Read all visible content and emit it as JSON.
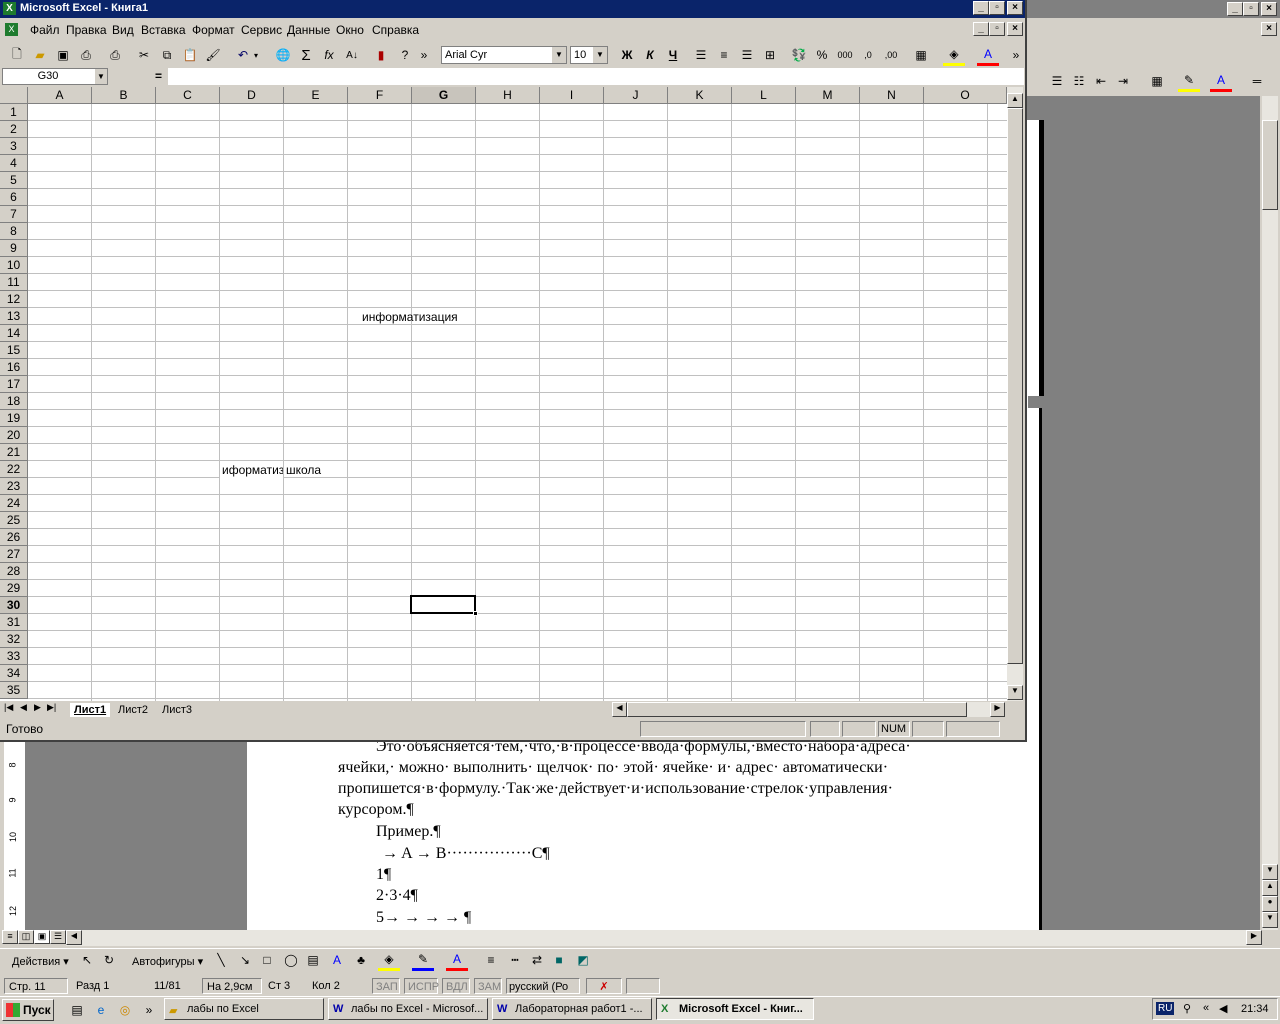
{
  "excel": {
    "title": "Microsoft Excel - Книга1",
    "menu": [
      "Файл",
      "Правка",
      "Вид",
      "Вставка",
      "Формат",
      "Сервис",
      "Данные",
      "Окно",
      "Справка"
    ],
    "font_name": "Arial Cyr",
    "font_size": "10",
    "bold": "Ж",
    "italic": "К",
    "underline": "Ч",
    "name_box": "G30",
    "formula_eq": "=",
    "columns": [
      "A",
      "B",
      "C",
      "D",
      "E",
      "F",
      "G",
      "H",
      "I",
      "J",
      "K",
      "L",
      "M",
      "N",
      "O"
    ],
    "rows": [
      "1",
      "2",
      "3",
      "4",
      "5",
      "6",
      "7",
      "8",
      "9",
      "10",
      "11",
      "12",
      "13",
      "14",
      "15",
      "16",
      "17",
      "18",
      "19",
      "20",
      "21",
      "22",
      "23",
      "24",
      "25",
      "26",
      "27",
      "28",
      "29",
      "30",
      "31",
      "32",
      "33",
      "34",
      "35"
    ],
    "cells": {
      "F13": "информатизация",
      "D22": "иформатиз",
      "E22": "школа"
    },
    "sheets": [
      "Лист1",
      "Лист2",
      "Лист3"
    ],
    "status_ready": "Готово",
    "status_num": "NUM"
  },
  "word": {
    "paragraph_lines": [
      "Это·объясняется·тем,·что,·в·процессе·ввода·формулы,·вместо·набора·адреса·",
      "ячейки,· можно· выполнить· щелчок· по· этой· ячейке· и· адрес· автоматически·",
      "пропишется·в·формулу.·Так·же·действует·и·использование·стрелок·управления·",
      "курсором.¶"
    ],
    "example": "Пример.¶",
    "line_abc": "→  A  →  B················C¶",
    "line1": "1¶",
    "line234": "2·3·4¶",
    "line5": "5→     →         →         →     ¶",
    "ruler_numbers": [
      "8",
      "9",
      "10",
      "11",
      "12"
    ],
    "draw_actions": "Действия",
    "draw_autoshapes": "Автофигуры",
    "status": {
      "page": "Стр. 11",
      "section": "Разд 1",
      "pages": "11/81",
      "at": "На 2,9см",
      "line": "Ст 3",
      "col": "Кол 2",
      "rec": "ЗАП",
      "trk": "ИСПР",
      "ext": "ВДЛ",
      "ovr": "ЗАМ",
      "lang": "русский (Ро"
    }
  },
  "taskbar": {
    "start": "Пуск",
    "tasks": [
      "лабы по Excel",
      "лабы по Excel - Microsof...",
      "Лабораторная работ1 -...",
      "Microsoft Excel - Книг..."
    ],
    "lang": "RU",
    "time": "21:34"
  }
}
